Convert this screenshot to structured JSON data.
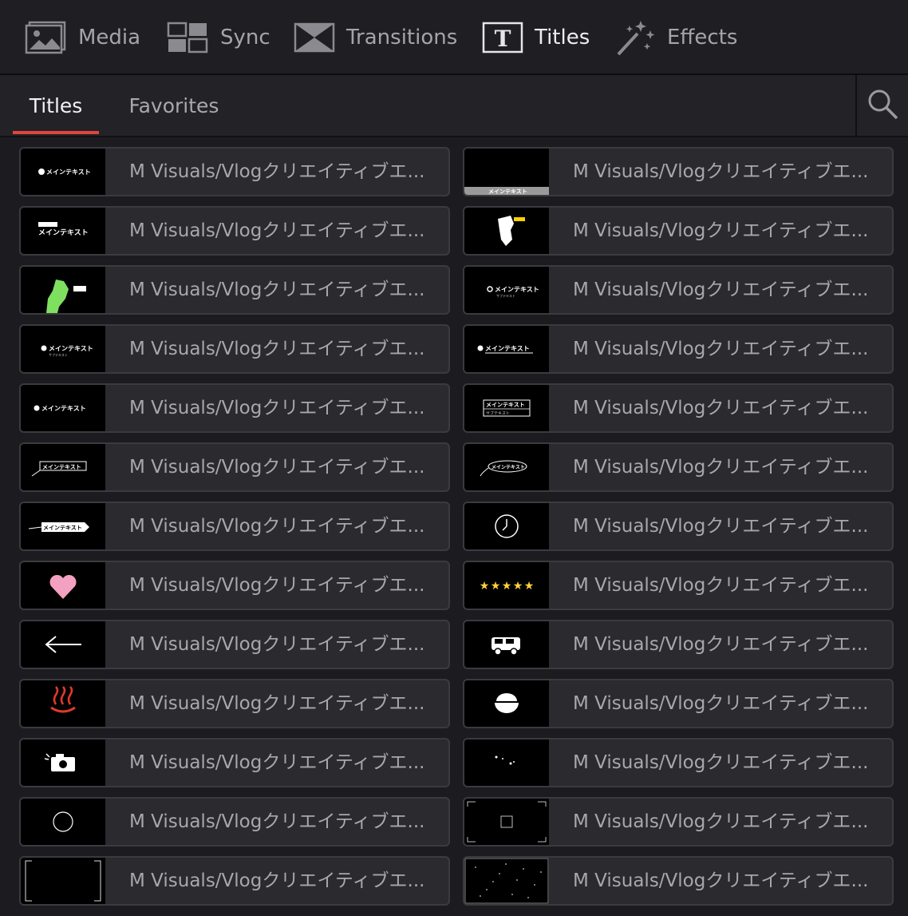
{
  "nav": {
    "items": [
      {
        "id": "media",
        "label": "Media",
        "icon": "media-icon",
        "active": false
      },
      {
        "id": "sync",
        "label": "Sync",
        "icon": "sync-icon",
        "active": false
      },
      {
        "id": "transitions",
        "label": "Transitions",
        "icon": "transitions-icon",
        "active": false
      },
      {
        "id": "titles",
        "label": "Titles",
        "icon": "titles-icon",
        "active": true
      },
      {
        "id": "effects",
        "label": "Effects",
        "icon": "effects-icon",
        "active": false
      }
    ]
  },
  "tabs": {
    "items": [
      {
        "label": "Titles",
        "active": true
      },
      {
        "label": "Favorites",
        "active": false
      }
    ],
    "search_icon": "search-icon",
    "accent": "#e0453a"
  },
  "titles": [
    {
      "label": "M Visuals/Vlogクリエイティブエ...",
      "thumb": "person-main-text"
    },
    {
      "label": "M Visuals/Vlogクリエイティブエ...",
      "thumb": "bottom-bar-main-text"
    },
    {
      "label": "M Visuals/Vlogクリエイティブエ...",
      "thumb": "stacked-main-text"
    },
    {
      "label": "M Visuals/Vlogクリエイティブエ...",
      "thumb": "map-white"
    },
    {
      "label": "M Visuals/Vlogクリエイティブエ...",
      "thumb": "map-green"
    },
    {
      "label": "M Visuals/Vlogクリエイティブエ...",
      "thumb": "pin-main-text-small"
    },
    {
      "label": "M Visuals/Vlogクリエイティブエ...",
      "thumb": "pin-main-sub-text"
    },
    {
      "label": "M Visuals/Vlogクリエイティブエ...",
      "thumb": "pin-underline-text"
    },
    {
      "label": "M Visuals/Vlogクリエイティブエ...",
      "thumb": "pin-main-text"
    },
    {
      "label": "M Visuals/Vlogクリエイティブエ...",
      "thumb": "boxed-main-sub-text"
    },
    {
      "label": "M Visuals/Vlogクリエイティブエ...",
      "thumb": "callout-box-text"
    },
    {
      "label": "M Visuals/Vlogクリエイティブエ...",
      "thumb": "callout-oval-text"
    },
    {
      "label": "M Visuals/Vlogクリエイティブエ...",
      "thumb": "callout-tag-text"
    },
    {
      "label": "M Visuals/Vlogクリエイティブエ...",
      "thumb": "clock-icon"
    },
    {
      "label": "M Visuals/Vlogクリエイティブエ...",
      "thumb": "heart-icon"
    },
    {
      "label": "M Visuals/Vlogクリエイティブエ...",
      "thumb": "five-stars-icon"
    },
    {
      "label": "M Visuals/Vlogクリエイティブエ...",
      "thumb": "arrow-left-icon"
    },
    {
      "label": "M Visuals/Vlogクリエイティブエ...",
      "thumb": "car-icon"
    },
    {
      "label": "M Visuals/Vlogクリエイティブエ...",
      "thumb": "hot-spring-icon"
    },
    {
      "label": "M Visuals/Vlogクリエイティブエ...",
      "thumb": "rice-bowl-icon"
    },
    {
      "label": "M Visuals/Vlogクリエイティブエ...",
      "thumb": "camera-icon"
    },
    {
      "label": "M Visuals/Vlogクリエイティブエ...",
      "thumb": "sparkle-dots"
    },
    {
      "label": "M Visuals/Vlogクリエイティブエ...",
      "thumb": "circle-outline"
    },
    {
      "label": "M Visuals/Vlogクリエイティブエ...",
      "thumb": "viewfinder-frame"
    },
    {
      "label": "M Visuals/Vlogクリエイティブエ...",
      "thumb": "bracket-frame"
    },
    {
      "label": "M Visuals/Vlogクリエイティブエ...",
      "thumb": "particles-frame"
    }
  ],
  "thumb_texts": {
    "main": "メインテキスト",
    "sub": "サブテキスト"
  }
}
